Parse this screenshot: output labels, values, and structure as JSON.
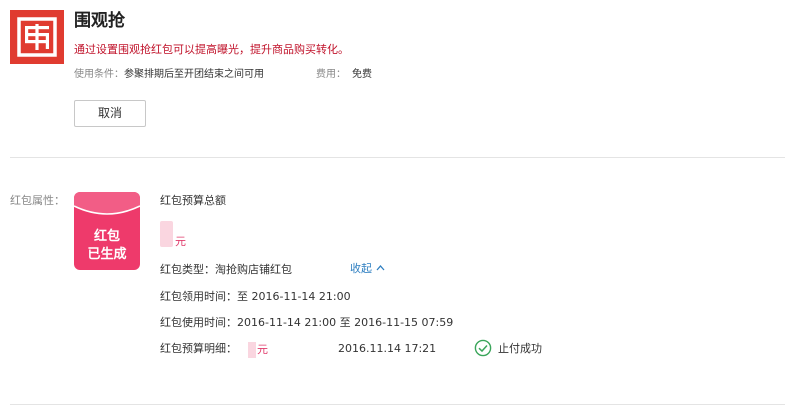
{
  "header": {
    "title": "围观抢",
    "description": "通过设置围观抢红包可以提高曝光，提升商品购买转化。",
    "condition_label": "使用条件：",
    "condition_value": "参聚排期后至开团结束之间可用",
    "fee_label": "费用：",
    "fee_value": "免费",
    "cancel_label": "取消"
  },
  "packet_section": {
    "attr_label": "红包属性：",
    "badge_line1": "红包",
    "badge_line2": "已生成",
    "budget_total_label": "红包预算总额",
    "amount_unit": "元",
    "type_label": "红包类型：",
    "type_value": "淘抢购店铺红包",
    "collapse_label": "收起",
    "claim_time_label": "红包领用时间：",
    "claim_time_value": "至 2016-11-14 21:00",
    "use_time_label": "红包使用时间：",
    "use_time_value": "2016-11-14 21:00 至 2016-11-15 07:59",
    "detail_label": "红包预算明细：",
    "detail_unit": "元",
    "detail_date": "2016.11.14 17:21",
    "detail_status": "止付成功"
  },
  "colors": {
    "logo_red": "#e03b30",
    "accent_pink": "#ee3a6b",
    "description_red": "#c0122a",
    "link_blue": "#2f7fc1",
    "success_green": "#3aa55a"
  },
  "icons": {
    "logo": "seal-logo-icon",
    "collapse": "chevron-up-icon",
    "status": "check-circle-icon"
  }
}
